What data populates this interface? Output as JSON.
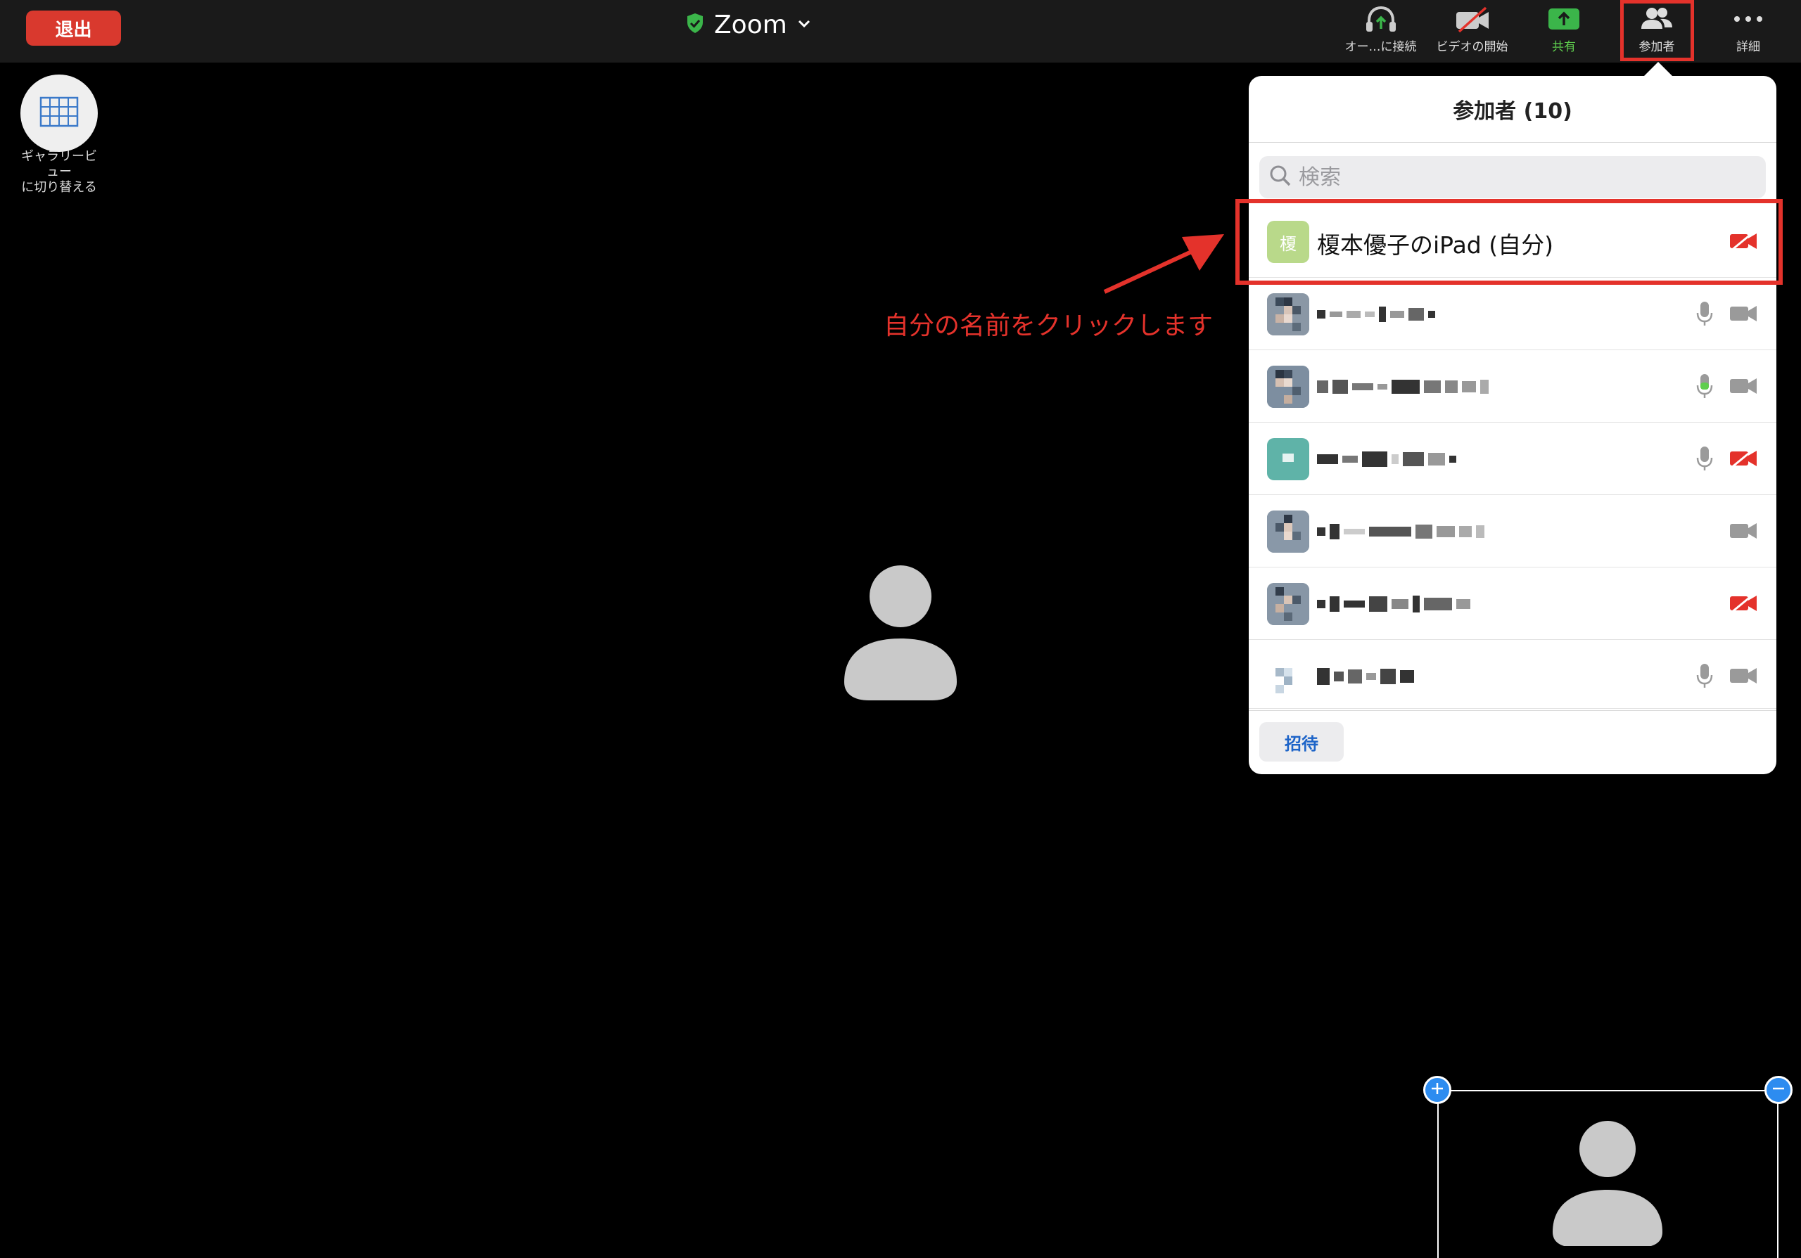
{
  "topbar": {
    "leave_label": "退出",
    "meeting_title": "Zoom",
    "items": [
      {
        "label": "オー…に接続",
        "icon": "headphones-icon"
      },
      {
        "label": "ビデオの開始",
        "icon": "video-off-icon"
      },
      {
        "label": "共有",
        "icon": "share-screen-icon"
      },
      {
        "label": "参加者",
        "icon": "participants-icon"
      },
      {
        "label": "詳細",
        "icon": "more-icon"
      }
    ]
  },
  "gallery": {
    "label": "ギャラリービ\nュー\nに切り替える"
  },
  "annotation": {
    "text": "自分の名前をクリックします"
  },
  "panel": {
    "title": "参加者 (10)",
    "search_placeholder": "検索",
    "self": {
      "avatar_initial": "榎",
      "name": "榎本優子のiPad (自分)",
      "avatar_color": "#b9d98a"
    },
    "invite_label": "招待"
  },
  "colors": {
    "accent_red": "#e4322b",
    "share_green": "#3bb54a",
    "leave_red": "#d9392e",
    "link_blue": "#1d64c8"
  }
}
